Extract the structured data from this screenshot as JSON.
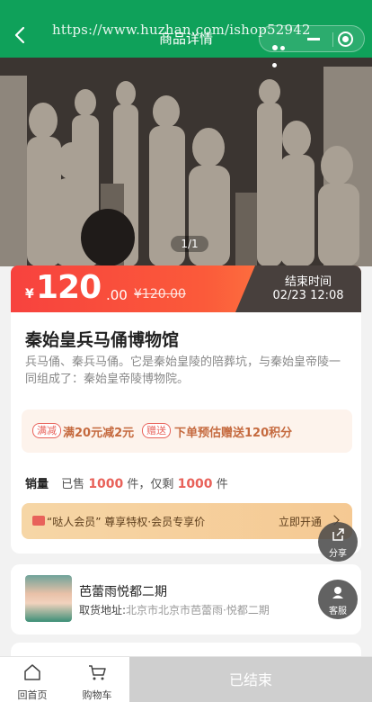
{
  "header": {
    "title": "商品详情",
    "watermark": "https://www.huzhan.com/ishop52942"
  },
  "gallery": {
    "pager": "1/1"
  },
  "price": {
    "currency": "¥",
    "amount": "120",
    "cents": ".00",
    "original": "¥120.00",
    "end_label": "结束时间",
    "end_time": "02/23 12:08"
  },
  "product": {
    "name": "秦始皇兵马俑博物馆",
    "description": "兵马俑、秦兵马俑。它是秦始皇陵的陪葬坑，与秦始皇帝陵一同组成了：秦始皇帝陵博物院。"
  },
  "promotions": [
    {
      "tag": "满减",
      "text": "满20元减2元"
    },
    {
      "tag": "赠送",
      "text": "下单预估赠送120积分"
    }
  ],
  "sales": {
    "label": "销量",
    "sold_prefix": "已售",
    "sold": "1000",
    "sold_unit": "件，仅剩",
    "remaining": "1000",
    "remaining_unit": "件"
  },
  "vip": {
    "text": "“哒人会员” 尊享特权·会员专享价",
    "action": "立即开通"
  },
  "shop": {
    "name": "芭蕾雨悦都二期",
    "address_label": "取货地址:",
    "address": "北京市北京市芭蕾雨·悦都二期"
  },
  "floats": {
    "share": "分享",
    "service": "客服"
  },
  "bottom": {
    "home": "回首页",
    "cart": "购物车",
    "status_button": "已结束"
  },
  "colors": {
    "brand": "#0fa15a",
    "price_red": "#f7423e",
    "accent": "#e8625a"
  }
}
